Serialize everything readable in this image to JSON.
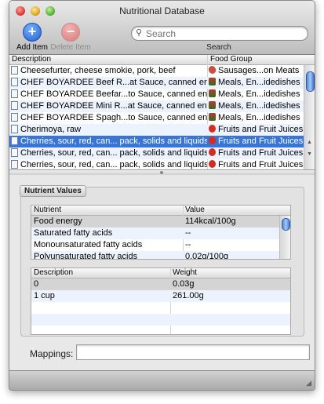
{
  "window": {
    "title": "Nutritional Database"
  },
  "toolbar": {
    "add_label": "Add Item",
    "delete_label": "Delete Item",
    "search_placeholder": "Search",
    "search_label": "Search"
  },
  "food_table": {
    "headers": {
      "description": "Description",
      "group": "Food Group"
    },
    "rows": [
      {
        "description": "Cheesefurter, cheese smokie, pork, beef",
        "group": "Sausages...on Meats",
        "icon": "sausage-icon"
      },
      {
        "description": "CHEF BOYARDEE Beef R...at Sauce, canned entree",
        "group": "Meals, En...idedishes",
        "icon": "meal-icon"
      },
      {
        "description": "CHEF BOYARDEE Beefar...to Sauce, canned entree",
        "group": "Meals, En...idedishes",
        "icon": "meal-icon"
      },
      {
        "description": "CHEF BOYARDEE Mini R...at Sauce, canned entree",
        "group": "Meals, En...idedishes",
        "icon": "meal-icon"
      },
      {
        "description": "CHEF BOYARDEE Spagh...to Sauce, canned entree",
        "group": "Meals, En...idedishes",
        "icon": "meal-icon"
      },
      {
        "description": "Cherimoya, raw",
        "group": "Fruits and Fruit Juices",
        "icon": "fruit-icon"
      },
      {
        "description": "Cherries, sour, red, can... pack, solids and liquids",
        "group": "Fruits and Fruit Juices",
        "icon": "fruit-icon",
        "selected": true
      },
      {
        "description": "Cherries, sour, red, can... pack, solids and liquids",
        "group": "Fruits and Fruit Juices",
        "icon": "fruit-icon"
      },
      {
        "description": "Cherries, sour, red, can... pack, solids and liquids",
        "group": "Fruits and Fruit Juices",
        "icon": "fruit-icon"
      }
    ]
  },
  "nutrients": {
    "section_label": "Nutrient Values",
    "headers": {
      "nutrient": "Nutrient",
      "value": "Value"
    },
    "rows": [
      {
        "nutrient": "Food energy",
        "value": "114kcal/100g"
      },
      {
        "nutrient": "Saturated fatty acids",
        "value": "--"
      },
      {
        "nutrient": "Monounsaturated fatty acids",
        "value": "--"
      },
      {
        "nutrient": "Polyunsaturated fatty acids",
        "value": "0.02g/100g"
      }
    ]
  },
  "weights": {
    "headers": {
      "description": "Description",
      "weight": "Weight"
    },
    "rows": [
      {
        "description": "0",
        "weight": "0.03g"
      },
      {
        "description": "1 cup",
        "weight": "261.00g"
      }
    ]
  },
  "mappings": {
    "label": "Mappings:",
    "value": ""
  }
}
